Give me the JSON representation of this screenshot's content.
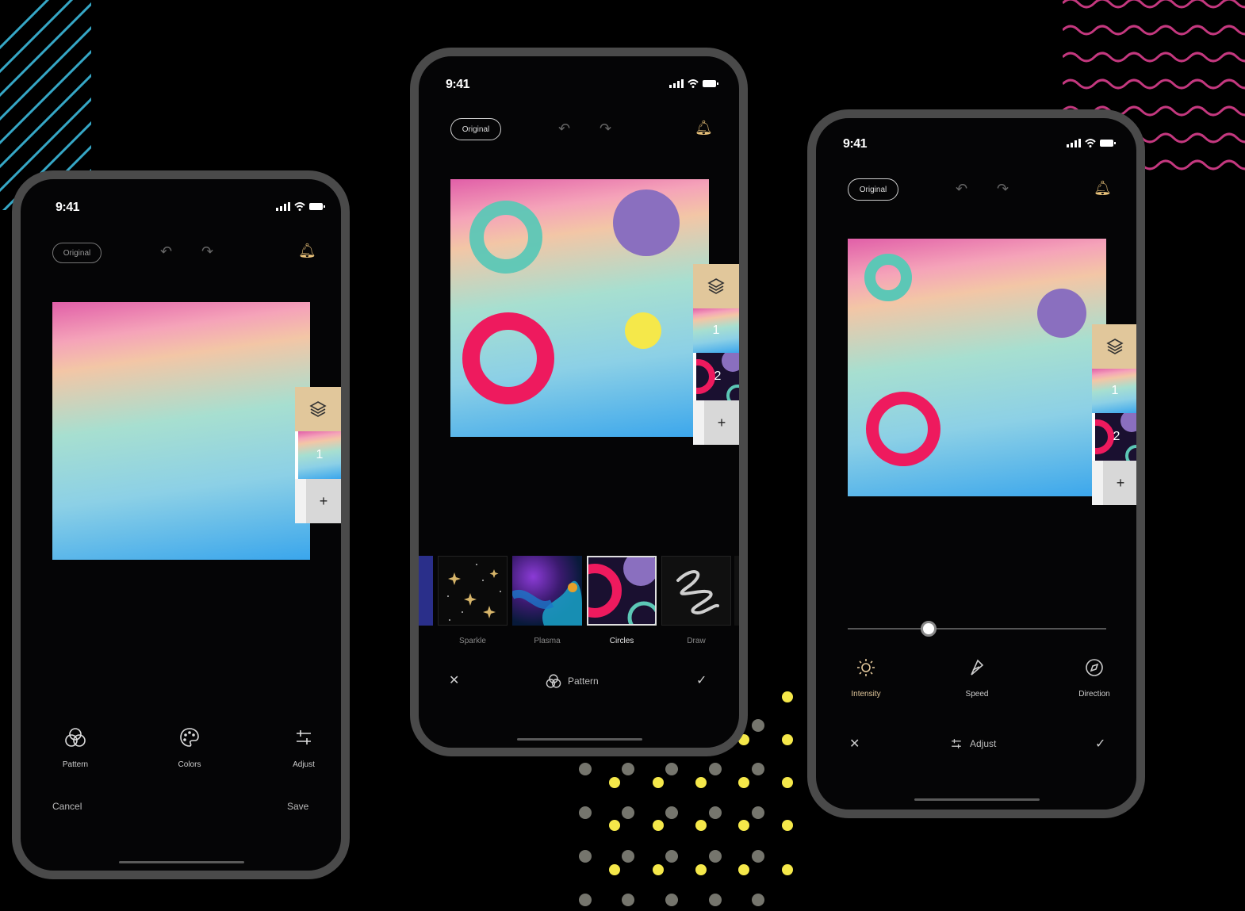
{
  "status": {
    "time": "9:41"
  },
  "top_bar": {
    "original_label": "Original"
  },
  "colors": {
    "accent_gold": "#e1c79b",
    "ring_pink": "#ee1a5e",
    "teal_ring": "#5cc7b6",
    "purple_circle": "#8a6fbf",
    "yellow_dot": "#f5e84a"
  },
  "phone1": {
    "layers": {
      "layer1_number": "1",
      "add_label": "+"
    },
    "tools": [
      {
        "icon": "pattern-icon",
        "label": "Pattern"
      },
      {
        "icon": "palette-icon",
        "label": "Colors"
      },
      {
        "icon": "sliders-icon",
        "label": "Adjust"
      }
    ],
    "cancel_label": "Cancel",
    "save_label": "Save"
  },
  "phone2": {
    "layers": {
      "layer1_number": "1",
      "layer2_number": "2",
      "add_label": "+"
    },
    "patterns": [
      {
        "label": "Sparkle",
        "selected": false
      },
      {
        "label": "Plasma",
        "selected": false
      },
      {
        "label": "Circles",
        "selected": true
      },
      {
        "label": "Draw",
        "selected": false
      }
    ],
    "bottom_title": "Pattern"
  },
  "phone3": {
    "layers": {
      "layer1_number": "1",
      "layer2_number": "2",
      "add_label": "+"
    },
    "slider_value": 0.3,
    "tools": [
      {
        "icon": "sun-icon",
        "label": "Intensity",
        "active": true
      },
      {
        "icon": "speed-icon",
        "label": "Speed",
        "active": false
      },
      {
        "icon": "compass-icon",
        "label": "Direction",
        "active": false
      }
    ],
    "bottom_title": "Adjust"
  }
}
